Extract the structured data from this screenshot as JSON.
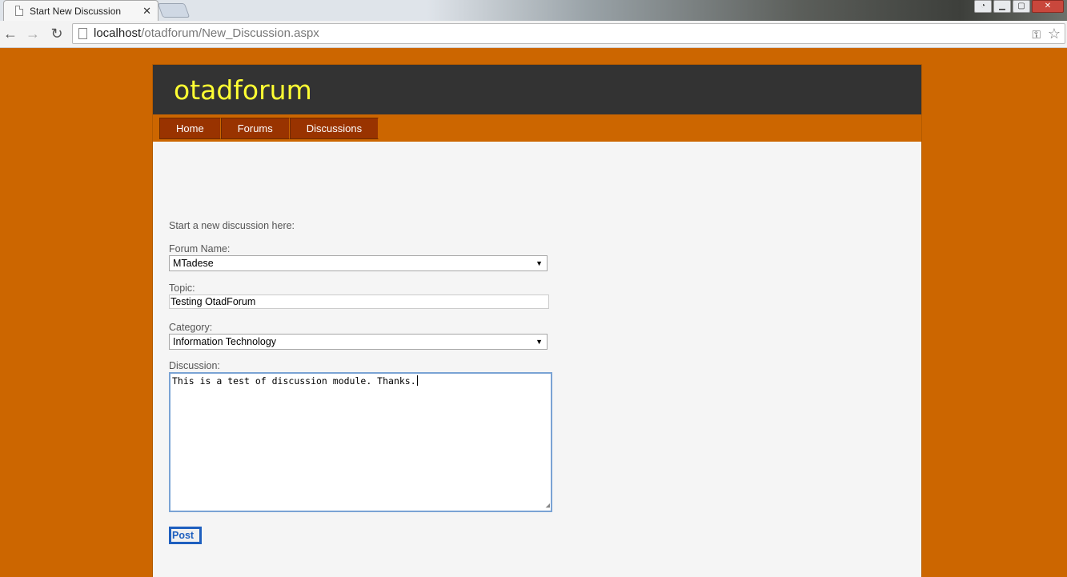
{
  "browser": {
    "tab_title": "Start New Discussion",
    "tab_close": "✕",
    "url_host": "localhost",
    "url_path": "/otadforum/New_Discussion.aspx"
  },
  "site": {
    "logo": "otadforum",
    "nav": [
      "Home",
      "Forums",
      "Discussions"
    ]
  },
  "form": {
    "intro": "Start a new discussion here:",
    "forum_label": "Forum Name:",
    "forum_value": "MTadese",
    "topic_label": "Topic:",
    "topic_value": "Testing OtadForum",
    "category_label": "Category:",
    "category_value": "Information Technology",
    "discussion_label": "Discussion:",
    "discussion_value": "This is a test of discussion module. Thanks.",
    "post_button": "Post"
  },
  "colors": {
    "page_background": "#cc6600",
    "header_background": "#333333",
    "logo_color": "#ffff33",
    "nav_button": "#993300"
  }
}
